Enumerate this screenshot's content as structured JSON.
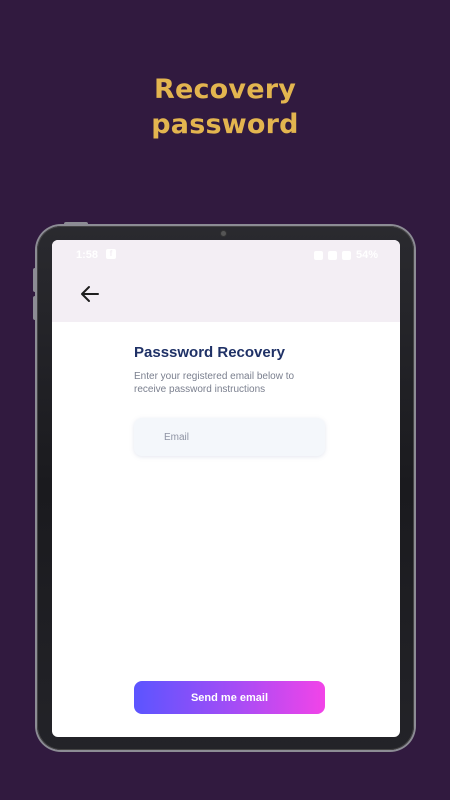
{
  "promo": {
    "title_line1": "Recovery",
    "title_line2": "password"
  },
  "colors": {
    "background": "#311a3f",
    "promo_title": "#e3b54f",
    "heading": "#1f3166",
    "button_gradient_start": "#5b55ff",
    "button_gradient_end": "#f244e8"
  },
  "statusbar": {
    "time": "1:58",
    "app_icon": "f",
    "battery": "54%",
    "icons": [
      "facebook-icon",
      "sync-icon",
      "wifi-icon",
      "signal-icon",
      "battery-icon"
    ]
  },
  "header": {
    "back_icon": "arrow-left-icon"
  },
  "main": {
    "heading": "Passsword Recovery",
    "instructions_line1": "Enter your registered email below to",
    "instructions_line2": "receive password instructions",
    "email_placeholder": "Email",
    "email_value": ""
  },
  "actions": {
    "send_label": "Send me email"
  }
}
